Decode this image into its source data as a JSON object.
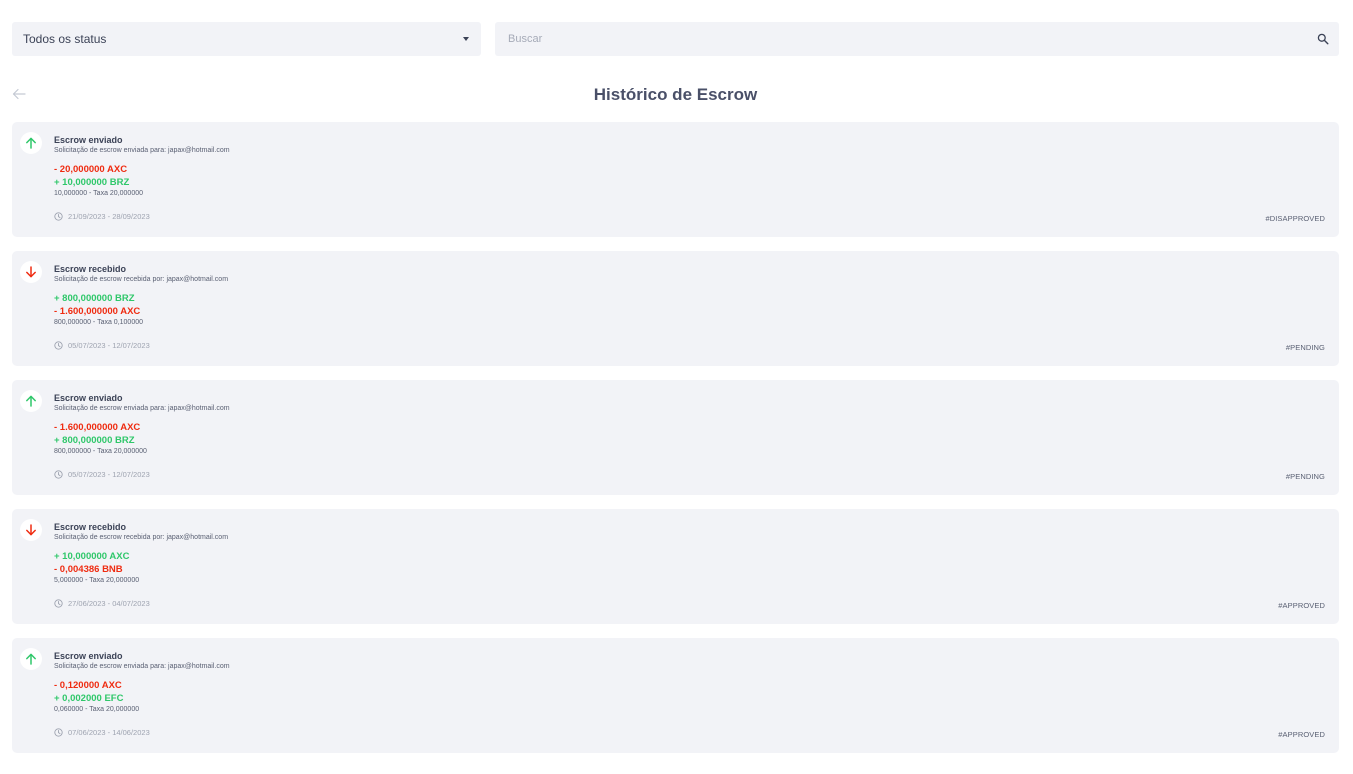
{
  "filters": {
    "status_select": "Todos os status",
    "search_placeholder": "Buscar"
  },
  "header": {
    "title": "Histórico de Escrow"
  },
  "colors": {
    "negative": "#ef2b10",
    "positive": "#2fc76a",
    "card_bg": "#f2f3f7"
  },
  "items": [
    {
      "direction": "sent",
      "icon": "arrow-up-icon",
      "title": "Escrow enviado",
      "subtitle": "Solicitação de escrow enviada para: japax@hotmail.com",
      "amounts": [
        {
          "text": "- 20,000000 AXC",
          "sign": "negative"
        },
        {
          "text": "+ 10,000000 BRZ",
          "sign": "positive"
        }
      ],
      "fee": "10,000000 - Taxa 20,000000",
      "dates": "21/09/2023 - 28/09/2023",
      "status": "#DISAPPROVED"
    },
    {
      "direction": "received",
      "icon": "arrow-down-icon",
      "title": "Escrow recebido",
      "subtitle": "Solicitação de escrow recebida por: japax@hotmail.com",
      "amounts": [
        {
          "text": "+ 800,000000 BRZ",
          "sign": "positive"
        },
        {
          "text": "- 1.600,000000 AXC",
          "sign": "negative"
        }
      ],
      "fee": "800,000000 - Taxa 0,100000",
      "dates": "05/07/2023 - 12/07/2023",
      "status": "#PENDING"
    },
    {
      "direction": "sent",
      "icon": "arrow-up-icon",
      "title": "Escrow enviado",
      "subtitle": "Solicitação de escrow enviada para: japax@hotmail.com",
      "amounts": [
        {
          "text": "- 1.600,000000 AXC",
          "sign": "negative"
        },
        {
          "text": "+ 800,000000 BRZ",
          "sign": "positive"
        }
      ],
      "fee": "800,000000 - Taxa 20,000000",
      "dates": "05/07/2023 - 12/07/2023",
      "status": "#PENDING"
    },
    {
      "direction": "received",
      "icon": "arrow-down-icon",
      "title": "Escrow recebido",
      "subtitle": "Solicitação de escrow recebida por: japax@hotmail.com",
      "amounts": [
        {
          "text": "+ 10,000000 AXC",
          "sign": "positive"
        },
        {
          "text": "- 0,004386 BNB",
          "sign": "negative"
        }
      ],
      "fee": "5,000000 - Taxa 20,000000",
      "dates": "27/06/2023 - 04/07/2023",
      "status": "#APPROVED"
    },
    {
      "direction": "sent",
      "icon": "arrow-up-icon",
      "title": "Escrow enviado",
      "subtitle": "Solicitação de escrow enviada para: japax@hotmail.com",
      "amounts": [
        {
          "text": "- 0,120000 AXC",
          "sign": "negative"
        },
        {
          "text": "+ 0,002000 EFC",
          "sign": "positive"
        }
      ],
      "fee": "0,060000 - Taxa 20,000000",
      "dates": "07/06/2023 - 14/06/2023",
      "status": "#APPROVED"
    }
  ]
}
